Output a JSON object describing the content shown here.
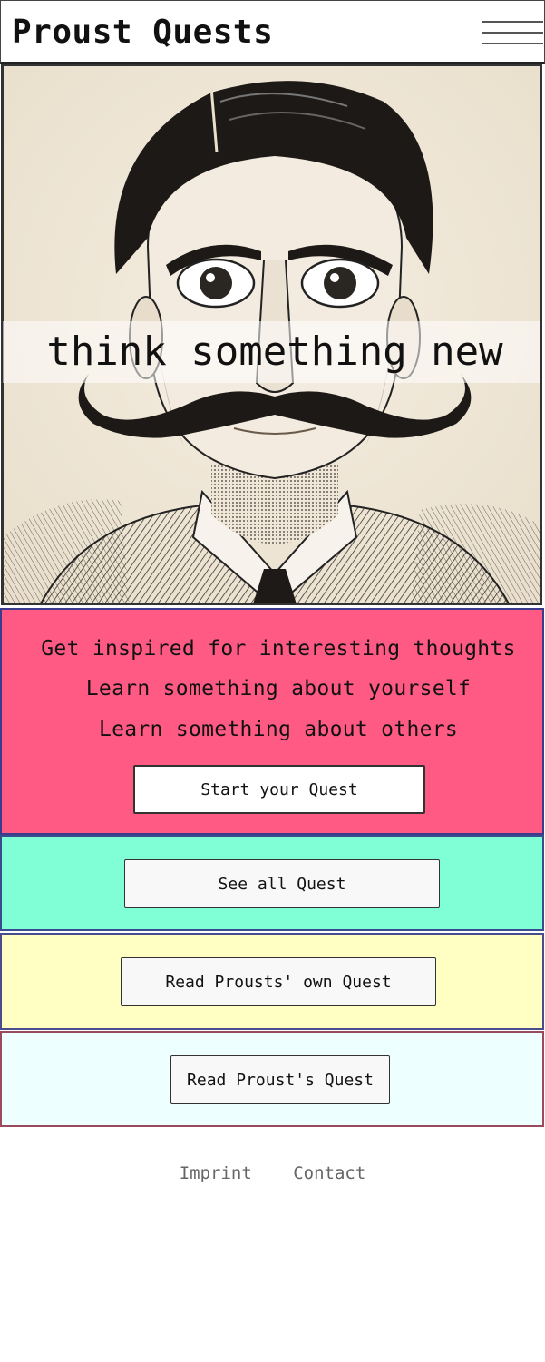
{
  "header": {
    "title": "Proust Quests",
    "menu_icon": "hamburger-menu-icon"
  },
  "hero": {
    "tagline": "think something new",
    "image": "illustrated portrait of Marcel Proust with mustache"
  },
  "intro": {
    "lines": [
      "Get inspired for interesting thoughts",
      "Learn something about yourself",
      "Learn something about others"
    ],
    "start_button": "Start your Quest"
  },
  "sections": {
    "all_quests_button": "See all Quest",
    "prousts_own_button": "Read Prousts' own Quest",
    "proust_quest_button": "Read Proust's Quest"
  },
  "footer": {
    "imprint": "Imprint",
    "contact": "Contact"
  },
  "colors": {
    "intro_bg": "#ff5a84",
    "all_bg": "#80ffd6",
    "own_bg": "#ffffc4",
    "proust_bg": "#eeffff"
  }
}
